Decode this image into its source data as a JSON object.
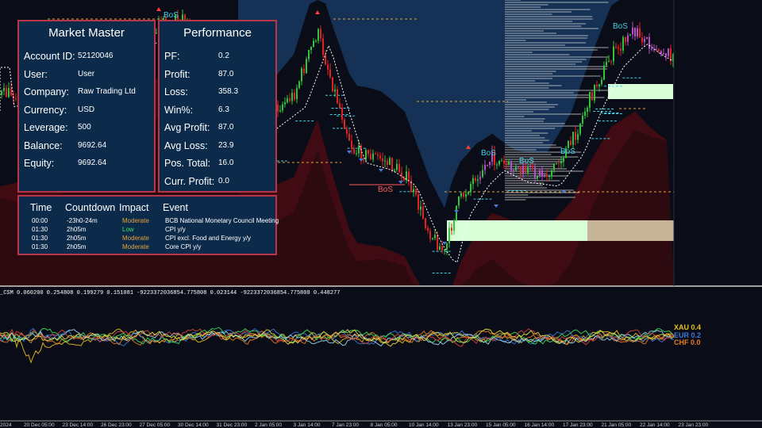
{
  "colors": {
    "background": "#0a0d17",
    "panel_bg": "#0c2a4a",
    "panel_border": "#b8364a",
    "bull_candle": "#2fc43a",
    "bear_candle": "#e02424",
    "neutral_candle": "#b84fc4",
    "band_upper": "#16355c",
    "band_lower": "#4a0c12",
    "supply_zone": "#d8ffd8",
    "bos_label": "#3fd0e6",
    "bos_bear_label": "#ff5a5a",
    "impact_moderate": "#e8a23a",
    "impact_low": "#3ee05a"
  },
  "market_master": {
    "title": "Market Master",
    "rows": [
      {
        "label": "Account ID:",
        "value": "52120046"
      },
      {
        "label": "User:",
        "value": "User"
      },
      {
        "label": "Company:",
        "value": "Raw Trading Ltd"
      },
      {
        "label": "Currency:",
        "value": "USD"
      },
      {
        "label": "Leverage:",
        "value": "500"
      },
      {
        "label": "Balance:",
        "value": "9692.64"
      },
      {
        "label": "Equity:",
        "value": "9692.64"
      }
    ]
  },
  "performance": {
    "title": "Performance",
    "rows": [
      {
        "label": "PF:",
        "value": "0.2"
      },
      {
        "label": "Profit:",
        "value": "87.0"
      },
      {
        "label": "Loss:",
        "value": "358.3"
      },
      {
        "label": "Win%:",
        "value": "6.3"
      },
      {
        "label": "Avg Profit:",
        "value": "87.0"
      },
      {
        "label": "Avg Loss:",
        "value": "23.9"
      },
      {
        "label": "Pos. Total:",
        "value": "16.0"
      },
      {
        "label": "Curr. Profit:",
        "value": "0.0"
      }
    ]
  },
  "news": {
    "headers": {
      "time": "Time",
      "countdown": "Countdown",
      "impact": "Impact",
      "event": "Event"
    },
    "rows": [
      {
        "time": "00:00",
        "countdown": "-23h0-24m",
        "impact": "Moderate",
        "event": "BCB National Monetary Council Meeting"
      },
      {
        "time": "01:30",
        "countdown": "2h05m",
        "impact": "Low",
        "event": "CPI y/y"
      },
      {
        "time": "01:30",
        "countdown": "2h05m",
        "impact": "Moderate",
        "event": "CPI excl. Food and Energy y/y"
      },
      {
        "time": "01:30",
        "countdown": "2h05m",
        "impact": "Moderate",
        "event": "Core CPI y/y"
      }
    ]
  },
  "bos_labels": [
    "BoS",
    "BoS",
    "BoS",
    "BoS",
    "BoS",
    "BoS"
  ],
  "indicator": {
    "label": "_CSM 0.060200 0.254808 0.199279 0.151081 -9223372036854.775808 0.023144 -9223372036854.775808 0.448277",
    "legend": [
      {
        "name": "XAU",
        "value": "0.4",
        "color": "#e8c020"
      },
      {
        "name": "EUR",
        "value": "0.2",
        "color": "#3a78d8"
      },
      {
        "name": "CHF",
        "value": "0.0",
        "color": "#e87a20"
      }
    ]
  },
  "time_axis": [
    "2024",
    "20 Dec 05:00",
    "23 Dec 14:00",
    "26 Dec 23:00",
    "27 Dec 05:00",
    "30 Dec 14:00",
    "31 Dec 23:00",
    "2 Jan 05:00",
    "3 Jan 14:00",
    "7 Jan 23:00",
    "8 Jan 05:00",
    "10 Jan 14:00",
    "13 Jan 23:00",
    "15 Jan 05:00",
    "16 Jan 14:00",
    "17 Jan 23:00",
    "21 Jan 05:00",
    "22 Jan 14:00",
    "23 Jan 23:00"
  ]
}
